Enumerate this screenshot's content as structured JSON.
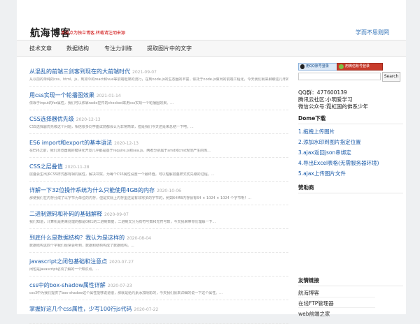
{
  "header": {
    "logo": "航海博客",
    "tagline": "本站点为独立博客,转载请注明来源",
    "motto": "学而不思则罔"
  },
  "nav": [
    "技术文章",
    "数据结构",
    "专注力训练",
    "提取图片中的文字"
  ],
  "articles": [
    {
      "title": "从混乱的前端三剑客到现在的大前端时代",
      "date": "2021-09-07",
      "desc": "从以前的单纯的css、html、js，到如今的react和vue等前端框架的流行，在到node.js的生态圈的丰富，依托于node.js做出的前端工程化，今天我们就来聊聊这几年的变化，..."
    },
    {
      "title": "用css实现一个轮播图效果",
      "date": "2021-01-14",
      "desc": "依靠于input的for属性，我们可以依靠radio控件的checked来用css实现一个轮播图效果。..."
    },
    {
      "title": "CSS选择器优先级",
      "date": "2020-12-13",
      "desc": "CSS选择器优先级这个问题，相信很多同学面试前都会认为非常简单，但是我们今天还是来总结一下吧。..."
    },
    {
      "title": "ES6 import和export的基本语法",
      "date": "2020-12-13",
      "desc": "在ES6之前，我们浏览器端的模块化开发几乎都是基于require.js和sea.js，两者分别属于amd和cmd规范产生的库..."
    },
    {
      "title": "CSS之层叠值",
      "date": "2020-11-28",
      "desc": "层叠会生出多CSS样式都有相同属性，解决冲突，为每个CSS属性设置一个最终值。可以理解层叠样式优先级的过程。..."
    },
    {
      "title": "详解一下32位操作系统为什么只能使用4GB的内存",
      "date": "2020-10-06",
      "desc": "那使我们在内存分成了以字节为单位的内存，但是实际上内存里还是有非常多的字节的，例如64MB内存就有64 × 1024 × 1024 个字节啊！..."
    },
    {
      "title": "二进制源码和补码的基础解释",
      "date": "2020-09-07",
      "desc": "我们知道，计算机是用来处理的都是0和1的二进制数据，二进制又分为有符号数和无符号数，今天我来带你们理解一下..."
    },
    {
      "title": "到底什么是数据结构？我认为是这样的",
      "date": "2020-08-04",
      "desc": "数据结构这四个字我们经常会听到，数据和结构构成了数据结构。..."
    },
    {
      "title": "javascript之闭包基础和注意点",
      "date": "2020-07-27",
      "desc": "闭包是javascript必须了解的一个知识点。..."
    },
    {
      "title": "css中的box-shadow属性详解",
      "date": "2020-07-23",
      "desc": "css3中为我们提供了box-shadow这个属性能够说道很，那就是给元素添加阴影的，今天我们就来详细的说一下这个属性。..."
    },
    {
      "title": "掌握好这几个css属性，少写100行js代码",
      "date": "2020-07-22",
      "desc": ""
    }
  ],
  "sidebar": {
    "qq_login": "用QQ账号登录",
    "wx_login": "用微信账号登录",
    "search_label": "Search",
    "search_value": "",
    "info": [
      "QQ群：477600139",
      "腾讯云社区:小明爱学习",
      "微信公众号:霓虹国的佛系少年"
    ],
    "demo_title": "Dome下载",
    "demos": [
      "1.拖拽上传图片",
      "2.添加水印到图片指定位置",
      "3.ajax返回json串绑定",
      "4.导出Excel表格(无需服务器环境)",
      "5.ajax上传图片文件"
    ],
    "sponsor_title": "赞助商",
    "friends_title": "友情链接",
    "friends": [
      "航海博客",
      "在线FTP管理器",
      "web前端之家"
    ]
  }
}
